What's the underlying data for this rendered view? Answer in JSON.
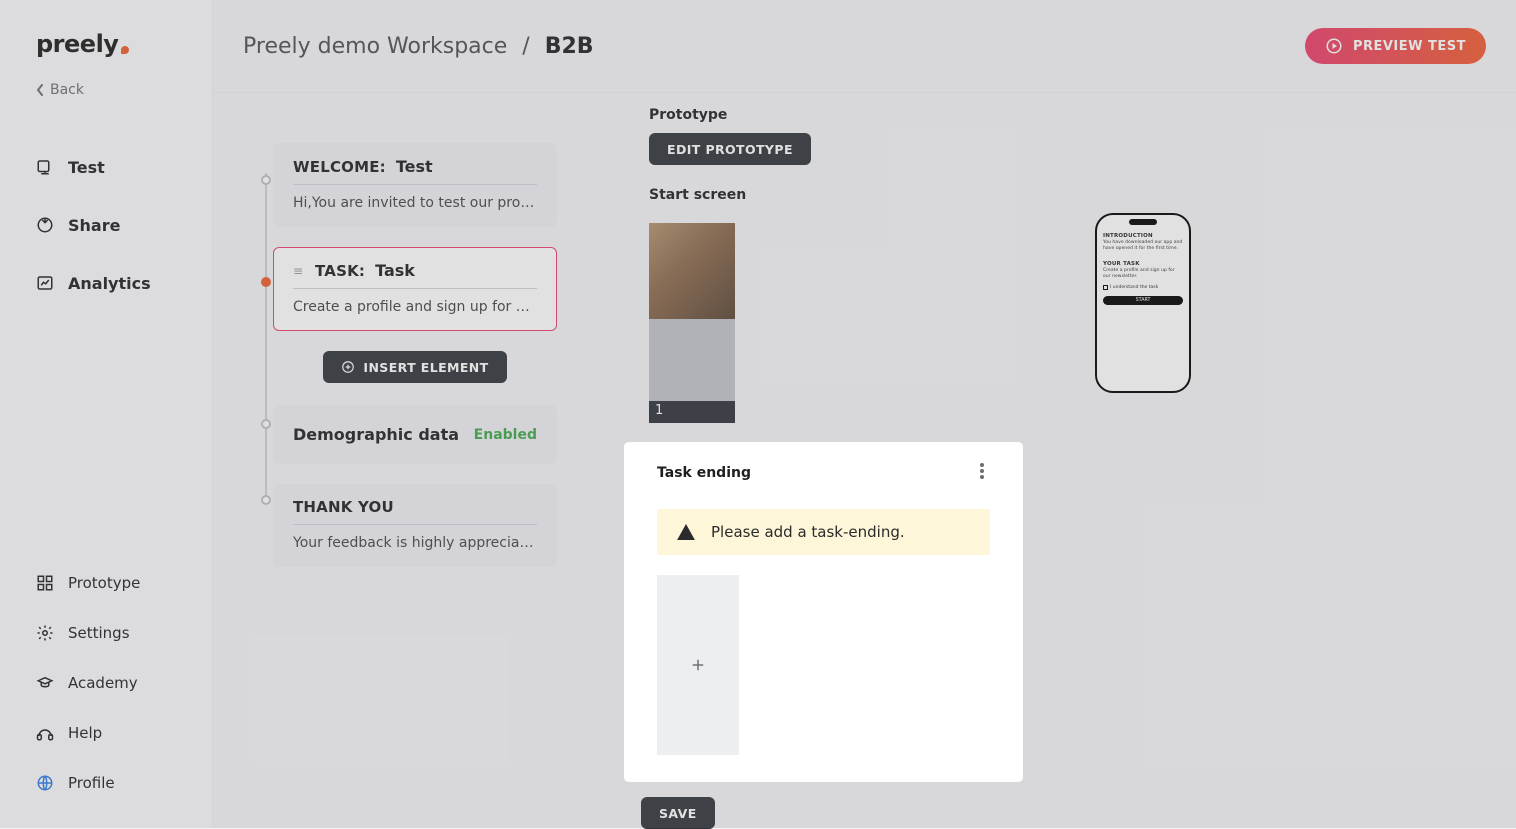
{
  "sidebar": {
    "logo": "preely",
    "back": "Back",
    "nav_top": [
      {
        "icon": "test",
        "label": "Test"
      },
      {
        "icon": "share",
        "label": "Share"
      },
      {
        "icon": "analytics",
        "label": "Analytics"
      }
    ],
    "nav_bottom": [
      {
        "icon": "prototype",
        "label": "Prototype"
      },
      {
        "icon": "settings",
        "label": "Settings"
      },
      {
        "icon": "academy",
        "label": "Academy"
      },
      {
        "icon": "help",
        "label": "Help"
      },
      {
        "icon": "profile",
        "label": "Profile"
      }
    ]
  },
  "header": {
    "workspace": "Preely demo Workspace",
    "sep": "/",
    "project": "B2B",
    "preview": "PREVIEW TEST"
  },
  "steps": {
    "welcome": {
      "label": "WELCOME:",
      "value": "Test",
      "body": "Hi,You are invited to test our prototype. Thank …"
    },
    "task": {
      "label": "TASK:",
      "value": "Task",
      "body": "Create a profile and sign up for our newsletter."
    },
    "insert": "INSERT ELEMENT",
    "demographic": {
      "label": "Demographic data",
      "status": "Enabled"
    },
    "thanks": {
      "label": "THANK YOU",
      "body": "Your feedback is highly appreciated.It is of gre…"
    }
  },
  "detail": {
    "prototype_label": "Prototype",
    "edit_prototype": "EDIT PROTOTYPE",
    "start_screen": "Start screen",
    "start_index": "1",
    "task_ending": "Task ending",
    "warning": "Please add a task-ending.",
    "save": "SAVE"
  },
  "phone": {
    "intro_h": "INTRODUCTION",
    "intro_p": "You have downloaded our app and have opened it for the first time.",
    "task_h": "YOUR TASK",
    "task_p": "Create a profile and sign up for our newsletter.",
    "check": "I understand the task",
    "start": "START"
  }
}
